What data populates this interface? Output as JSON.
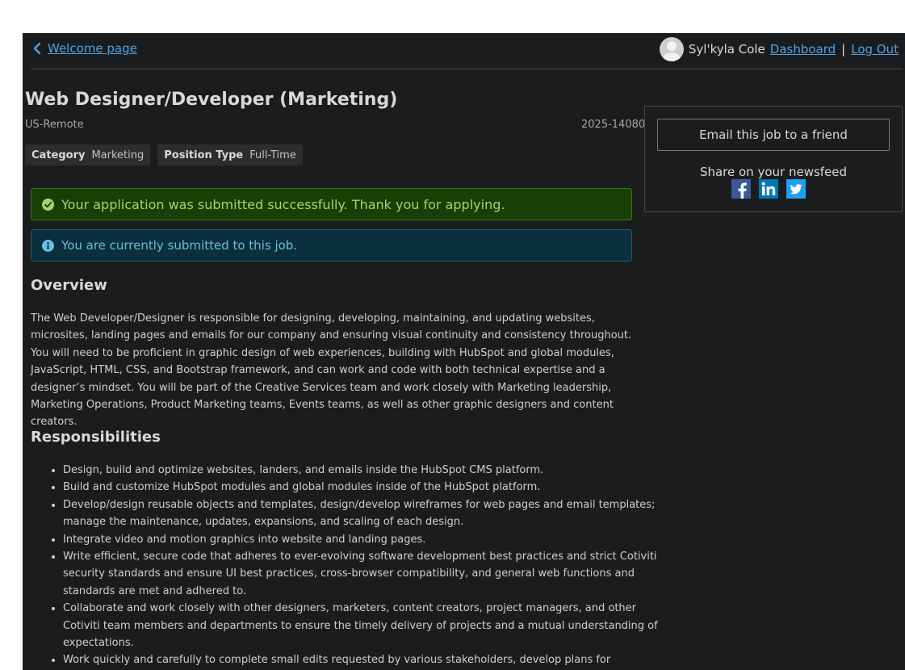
{
  "nav": {
    "back_label": "Welcome page",
    "user_name": "Syl'kyla Cole",
    "dashboard_label": "Dashboard",
    "separator": "|",
    "logout_label": "Log Out"
  },
  "job": {
    "title": "Web Designer/Developer (Marketing)",
    "location": "US-Remote",
    "id": "2025-14080",
    "tags": [
      {
        "label": "Category",
        "value": "Marketing"
      },
      {
        "label": "Position Type",
        "value": "Full-Time"
      }
    ]
  },
  "alerts": {
    "success": "Your application was submitted successfully. Thank you for applying.",
    "info": "You are currently submitted to this job."
  },
  "overview": {
    "heading": "Overview",
    "text": "The Web Developer/Designer is responsible for designing, developing, maintaining, and updating websites, microsites, landing pages and emails for our company and ensuring visual continuity and consistency throughout. You will need to be proficient in graphic design of web experiences, building with HubSpot and global modules, JavaScript, HTML, CSS, and Bootstrap framework, and can work and code with both technical expertise and a designer’s mindset. You will be part of the Creative Services team and work closely with Marketing leadership, Marketing Operations, Product Marketing teams, Events teams, as well as other graphic designers and content creators."
  },
  "responsibilities": {
    "heading": "Responsibilities",
    "items": [
      "Design, build and optimize websites, landers, and emails inside the HubSpot CMS platform.",
      "Build and customize HubSpot modules and global modules inside of the HubSpot platform.",
      "Develop/design reusable objects and templates, design/develop wireframes for web pages and email templates; manage the maintenance, updates, expansions, and scaling of each design.",
      "Integrate video and motion graphics into website and landing pages.",
      "Write efficient, secure code that adheres to ever-evolving software development best practices and strict Cotiviti security standards and ensure UI best practices, cross-browser compatibility, and general web functions and standards are met and adhered to.",
      "Collaborate and work closely with other designers, marketers, content creators, project managers, and other Cotiviti team members and departments to ensure the timely delivery of projects and a mutual understanding of expectations.",
      "Work quickly and carefully to complete small edits requested by various stakeholders, develop plans for"
    ]
  },
  "sidebar": {
    "email_button": "Email this job to a friend",
    "share_label": "Share on your newsfeed",
    "share_icons": [
      "facebook-icon",
      "linkedin-icon",
      "twitter-icon"
    ]
  },
  "colors": {
    "page_bg": "#1b1c1d",
    "link": "#4ea3e6",
    "success_bg": "#1a3f05",
    "success_text": "#9fd47c",
    "info_bg": "#0c2f3e",
    "info_text": "#6bbcdd",
    "facebook": "#3b5998",
    "linkedin": "#0077b5",
    "twitter": "#1da1f2"
  }
}
